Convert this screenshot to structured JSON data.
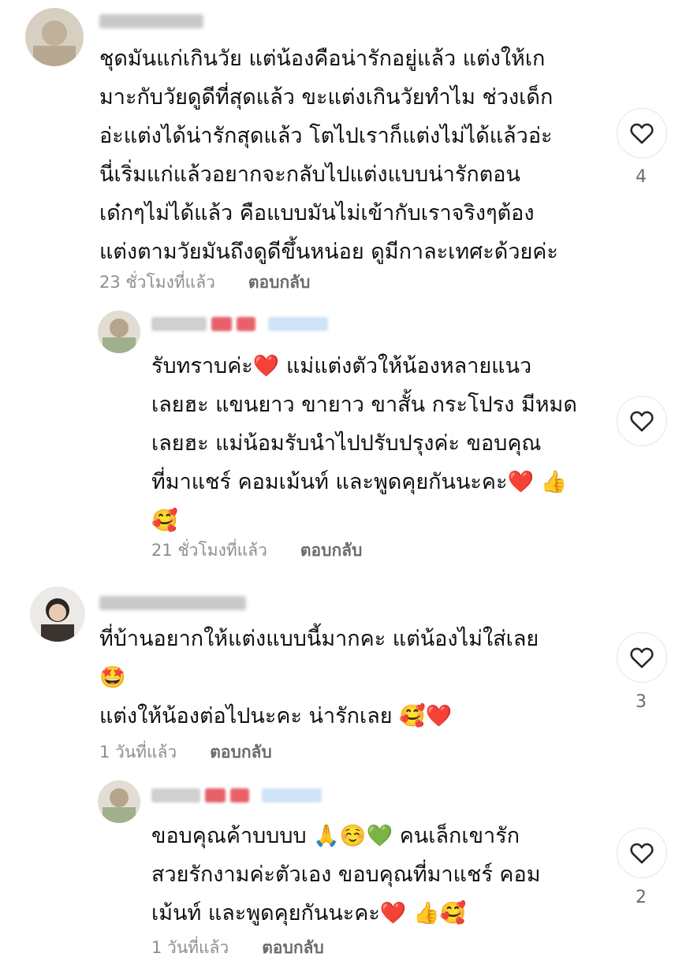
{
  "comments": [
    {
      "text": "ชุดมันแก่เกินวัย แต่น้องคือน่ารักอยู่แล้ว แต่งให้เก\nมาะกับวัยดูดีที่สุดแล้ว ขะแต่งเกินวัยทำไม ช่วงเด็ก\nอ่ะแต่งได้น่ารักสุดแล้ว โตไปเราก็แต่งไม่ได้แล้วอ่ะ\nนี่เริ่มแก่แล้วอยากจะกลับไปแต่งแบบน่ารักตอน\nเด๋กๆไม่ได้แล้ว คือแบบมันไม่เข้ากับเราจริงๆต้อง\nแต่งตามวัยมันถึงดูดีขึ้นหน่อย ดูมีกาละเทศะด้วยค่ะ",
      "time": "23 ชั่วโมงที่แล้ว",
      "reply_label": "ตอบกลับ",
      "like_count": "4"
    },
    {
      "text": "รับทราบค่ะ❤️ แม่แต่งตัวให้น้องหลายแนว\nเลยฮะ แขนยาว ขายาว ขาสั้น กระโปรง มีหมด\nเลยฮะ แม่น้อมรับนำไปปรับปรุงค่ะ ขอบคุณ\nที่มาแชร์ คอมเม้นท์ และพูดคุยกันนะคะ❤️ 👍\n🥰",
      "time": "21 ชั่วโมงที่แล้ว",
      "reply_label": "ตอบกลับ",
      "like_count": ""
    },
    {
      "text": "ที่บ้านอยากให้แต่งแบบนี้มากคะ แต่น้องไม่ใส่เลย\n🤩\nแต่งให้น้องต่อไปนะคะ น่ารักเลย 🥰❤️",
      "time": "1 วันที่แล้ว",
      "reply_label": "ตอบกลับ",
      "like_count": "3"
    },
    {
      "text": "ขอบคุณค้าบบบบ 🙏☺️💚 คนเล็กเขารัก\nสวยรักงามค่ะตัวเอง ขอบคุณที่มาแชร์ คอม\nเม้นท์ และพูดคุยกันนะคะ❤️ 👍🥰",
      "time": "1 วันที่แล้ว",
      "reply_label": "ตอบกลับ",
      "like_count": "2"
    }
  ],
  "icons": {
    "like": "heart-outline-icon"
  },
  "colors": {
    "meta": "#8e8e8e",
    "heart_stroke": "#262626",
    "chip_blue": "#cfe3f7",
    "chip_red": "#e8606a"
  }
}
